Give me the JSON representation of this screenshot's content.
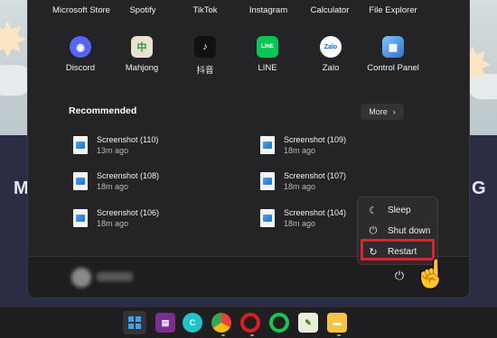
{
  "start_menu": {
    "top_row_labels": [
      "Microsoft Store",
      "Spotify",
      "TikTok",
      "Instagram",
      "Calculator",
      "File Explorer"
    ],
    "pinned": [
      {
        "label": "Discord",
        "icon": "discord-icon",
        "color": "#5865f2",
        "glyph": "◉"
      },
      {
        "label": "Mahjong",
        "icon": "mahjong-icon",
        "color": "#2f8f4f",
        "glyph": "🀄"
      },
      {
        "label": "抖音",
        "icon": "douyin-icon",
        "color": "#111111",
        "glyph": "♪"
      },
      {
        "label": "LINE",
        "icon": "line-icon",
        "color": "#06c755",
        "glyph": "LINE"
      },
      {
        "label": "Zalo",
        "icon": "zalo-icon",
        "color": "#0068ff",
        "glyph": "Zalo"
      },
      {
        "label": "Control Panel",
        "icon": "control-panel-icon",
        "color": "#3a7bd5",
        "glyph": "▦"
      }
    ],
    "recommended": {
      "title": "Recommended",
      "more_label": "More",
      "items": [
        {
          "name": "Screenshot (110)",
          "time": "13m ago"
        },
        {
          "name": "Screenshot (109)",
          "time": "18m ago"
        },
        {
          "name": "Screenshot (108)",
          "time": "18m ago"
        },
        {
          "name": "Screenshot (107)",
          "time": "18m ago"
        },
        {
          "name": "Screenshot (106)",
          "time": "18m ago"
        },
        {
          "name": "Screenshot (104)",
          "time": "18m ago"
        }
      ]
    }
  },
  "power_menu": {
    "sleep": "Sleep",
    "shut_down": "Shut down",
    "restart": "Restart"
  },
  "desktop": {
    "left_letter": "M",
    "right_letter": "G"
  },
  "colors": {
    "highlight": "#e0242c",
    "menu_bg": "#242426"
  },
  "taskbar": {
    "items": [
      "start-button",
      "winrar-icon",
      "canva-icon",
      "chrome-icon",
      "opera-icon",
      "opera-gx-icon",
      "notepad-icon",
      "file-explorer-icon"
    ]
  }
}
